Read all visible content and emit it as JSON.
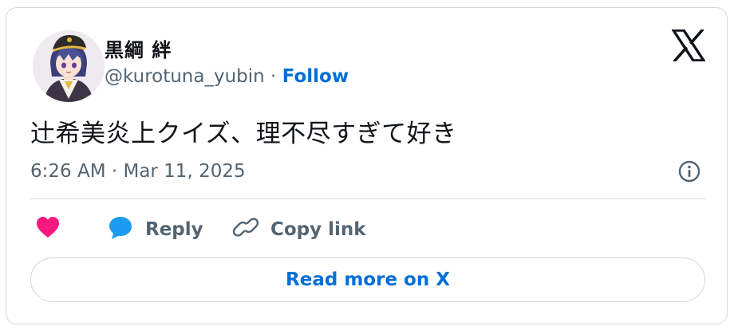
{
  "author": {
    "display_name": "黒綱 絆",
    "handle": "@kurotuna_yubin",
    "separator": " · ",
    "follow_label": "Follow"
  },
  "tweet": {
    "text": "辻希美炎上クイズ、理不尽すぎて好き",
    "timestamp": "6:26 AM · Mar 11, 2025"
  },
  "actions": {
    "reply_label": "Reply",
    "copy_link_label": "Copy link",
    "read_more_label": "Read more on X"
  },
  "icons": {
    "logo": "x-logo-icon",
    "info": "info-icon",
    "like": "heart-icon",
    "reply": "speech-bubble-icon",
    "copy": "link-icon"
  },
  "colors": {
    "text": "#0f1419",
    "secondary": "#536471",
    "link": "#006fd6",
    "heart": "#f91880",
    "reply": "#1d9bf0",
    "border": "#cfd9de"
  }
}
